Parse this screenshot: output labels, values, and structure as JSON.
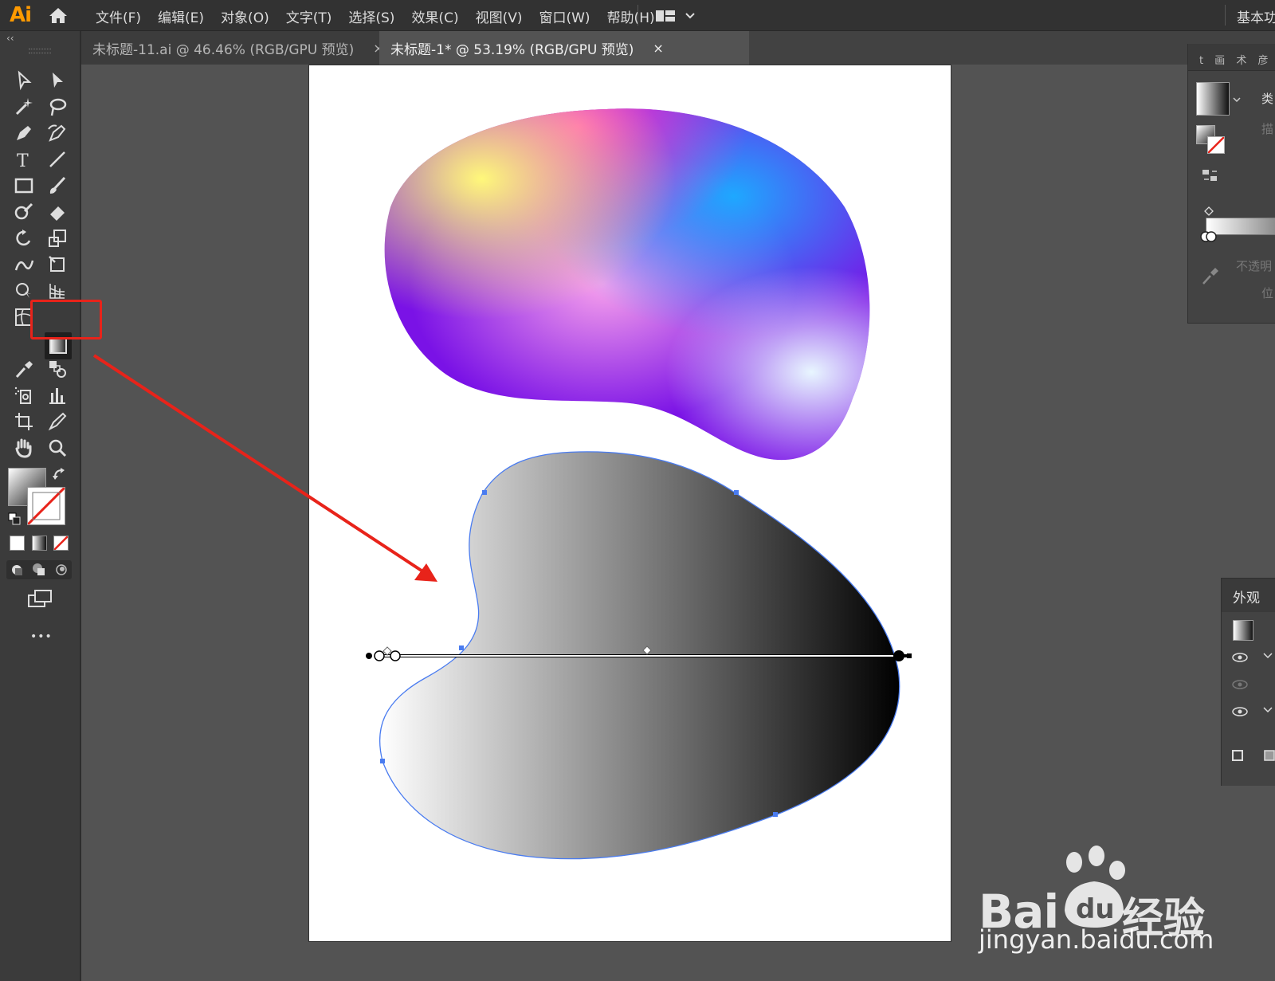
{
  "app": {
    "logo": "Ai",
    "workspace": "基本功能"
  },
  "menu": [
    "文件(F)",
    "编辑(E)",
    "对象(O)",
    "文字(T)",
    "选择(S)",
    "效果(C)",
    "视图(V)",
    "窗口(W)",
    "帮助(H)"
  ],
  "tabs": [
    {
      "label": "未标题-11.ai @ 46.46% (RGB/GPU 预览)",
      "close": "×",
      "active": false
    },
    {
      "label": "未标题-1* @ 53.19% (RGB/GPU 预览)",
      "close": "×",
      "active": true
    }
  ],
  "toolbar": {
    "collapse": "‹‹",
    "more": "•••",
    "highlighted_tool": "gradient-tool"
  },
  "gradient_panel": {
    "tabs_text": "t 画 术 彦 彦",
    "type_label": "类",
    "stroke_label": "描",
    "opacity_label": "不透明",
    "location_label": "位"
  },
  "appearance_panel": {
    "tab": "外观"
  },
  "watermark": {
    "brand": "Bai",
    "paw_text": "du",
    "cn": "经验",
    "url": "jingyan.baidu.com"
  },
  "colors": {
    "annotation": "#e8231a",
    "accent": "#ff9a00",
    "selection": "#4a7cf0"
  }
}
